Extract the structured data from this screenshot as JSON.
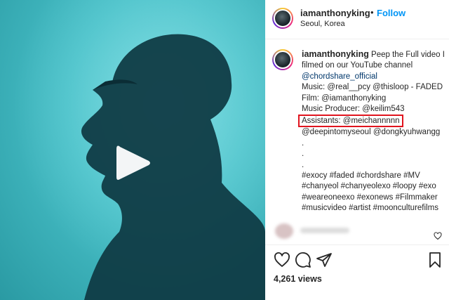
{
  "header": {
    "username": "iamanthonyking",
    "separator": "•",
    "follow_label": "Follow",
    "location": "Seoul, Korea"
  },
  "caption": {
    "username": "iamanthonyking",
    "lines": [
      "Peep the Full video I",
      "filmed on our YouTube channel",
      "@chordshare_official",
      "Music: @real__pcy @thisloop - FADED",
      "Film: @iamanthonyking",
      "Music Producer: @keilim543",
      "Assistants: @meichannnnn",
      "@deepintomyseoul @dongkyuhwangg",
      ".",
      ".",
      ".",
      "#exocy #faded #chordshare #MV",
      "#chanyeol #chanyeolexo #loopy #exo",
      "#weareoneexo #exonews #Filmmaker",
      "#musicvideo #artist #moonculturefilms"
    ]
  },
  "post": {
    "likes": "4,261 views"
  },
  "colors": {
    "follow": "#0095f6",
    "highlight_box": "#e0141e",
    "video_bg": "#48c0c8"
  },
  "icons": {
    "play": "play-icon",
    "like": "heart-icon",
    "comment": "comment-icon",
    "share": "share-icon",
    "save": "bookmark-icon"
  }
}
